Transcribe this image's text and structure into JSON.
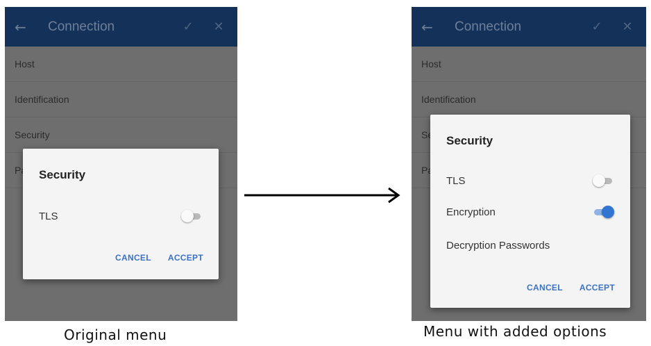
{
  "left_panel": {
    "appbar": {
      "back_icon": "←",
      "title": "Connection",
      "check_icon": "✓",
      "close_icon": "✕"
    },
    "list_items": [
      "Host",
      "Identification",
      "Security",
      "Pa"
    ],
    "dialog": {
      "title": "Security",
      "options": [
        {
          "label": "TLS",
          "state": "off"
        }
      ],
      "cancel_label": "CANCEL",
      "accept_label": "ACCEPT"
    },
    "caption": "Original menu"
  },
  "right_panel": {
    "appbar": {
      "back_icon": "←",
      "title": "Connection",
      "check_icon": "✓",
      "close_icon": "✕"
    },
    "list_items": [
      "Host",
      "Identification",
      "Se",
      "Pa"
    ],
    "dialog": {
      "title": "Security",
      "options": [
        {
          "label": "TLS",
          "state": "off"
        },
        {
          "label": "Encryption",
          "state": "on"
        },
        {
          "label": "Decryption Passwords",
          "state": "none"
        }
      ],
      "cancel_label": "CANCEL",
      "accept_label": "ACCEPT"
    },
    "caption": "Menu with added options"
  },
  "colors": {
    "appbar": "#143259",
    "overlay": "#6e6e6e",
    "dialog": "#f4f4f4",
    "accent": "#3b72c6",
    "toggle_on": "#3274d2"
  },
  "icons": [
    "back-arrow-icon",
    "check-icon",
    "close-icon",
    "right-arrow-icon"
  ]
}
